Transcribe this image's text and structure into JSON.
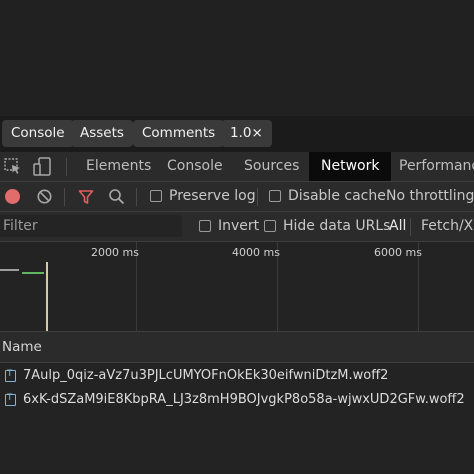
{
  "app_toolbar": {
    "buttons": [
      "Console",
      "Assets",
      "Comments",
      "1.0×"
    ]
  },
  "devtools_tabs": [
    "Elements",
    "Console",
    "Sources",
    "Network",
    "Performance"
  ],
  "active_tab": "Network",
  "network_toolbar": {
    "preserve_log": "Preserve log",
    "disable_cache": "Disable cache",
    "throttling": "No throttling"
  },
  "filter_bar": {
    "placeholder": "Filter",
    "invert": "Invert",
    "hide_data_urls": "Hide data URLs",
    "all": "All",
    "fetch_xhr": "Fetch/XH"
  },
  "overview": {
    "ticks": [
      "2000 ms",
      "4000 ms",
      "6000 ms"
    ]
  },
  "table": {
    "column_name": "Name",
    "rows": [
      "7Aulp_0qiz-aVz7u3PJLcUMYOFnOkEk30eifwniDtzM.woff2",
      "6xK-dSZaM9iE8KbpRA_LJ3z8mH9BOJvgkP8o58a-wjwxUD2GFw.woff2"
    ]
  },
  "colors": {
    "record": "#e06c6c",
    "filter_icon": "#e35d5d",
    "active_tab_bg": "#0b0b0b",
    "waterfall_green": "#5fb85f",
    "waterfall_gray": "#9e9e9e",
    "load_line": "#d8c9a3"
  }
}
